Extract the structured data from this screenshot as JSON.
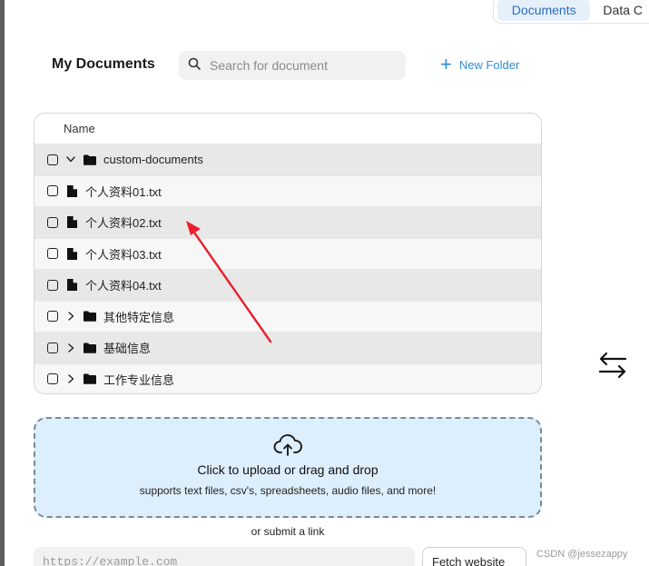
{
  "tabs": [
    {
      "label": "Documents",
      "active": true
    },
    {
      "label": "Data C",
      "active": false
    }
  ],
  "header": {
    "title": "My Documents",
    "search_placeholder": "Search for document",
    "new_folder_label": "New Folder"
  },
  "table": {
    "column_name": "Name",
    "rows": [
      {
        "type": "folder",
        "expanded": true,
        "name": "custom-documents",
        "shade": true
      },
      {
        "type": "file",
        "name": "个人资料01.txt",
        "shade": false
      },
      {
        "type": "file",
        "name": "个人资料02.txt",
        "shade": true
      },
      {
        "type": "file",
        "name": "个人资料03.txt",
        "shade": false
      },
      {
        "type": "file",
        "name": "个人资料04.txt",
        "shade": true
      },
      {
        "type": "folder",
        "expanded": false,
        "name": "其他特定信息",
        "shade": false
      },
      {
        "type": "folder",
        "expanded": false,
        "name": "基础信息",
        "shade": true
      },
      {
        "type": "folder",
        "expanded": false,
        "name": "工作专业信息",
        "shade": false
      }
    ]
  },
  "upload": {
    "title": "Click to upload or drag and drop",
    "subtitle": "supports text files, csv's, spreadsheets, audio files, and more!",
    "or_link": "or submit a link",
    "url_placeholder": "https://example.com",
    "fetch_label": "Fetch website"
  },
  "watermark": "CSDN @jessezappy",
  "colors": {
    "accent": "#2f8cd6",
    "upload_bg": "#ddeefc",
    "annotation_arrow": "#e8202a"
  }
}
